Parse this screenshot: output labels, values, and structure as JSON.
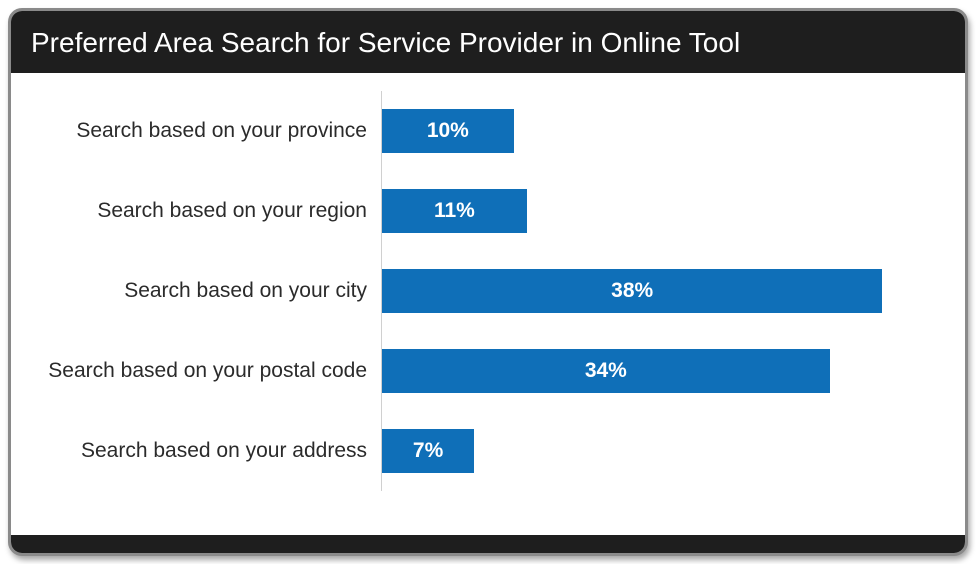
{
  "chart_data": {
    "type": "bar",
    "orientation": "horizontal",
    "title": "Preferred Area Search for Service Provider in Online Tool",
    "xlabel": "",
    "ylabel": "",
    "xlim": [
      0,
      42
    ],
    "categories": [
      "Search based on your province",
      "Search based on your region",
      "Search based on your city",
      "Search based on your postal code",
      "Search based on your address"
    ],
    "values": [
      10,
      11,
      38,
      34,
      7
    ],
    "value_labels": [
      "10%",
      "11%",
      "38%",
      "34%",
      "7%"
    ],
    "bar_color": "#0f6fb8"
  }
}
